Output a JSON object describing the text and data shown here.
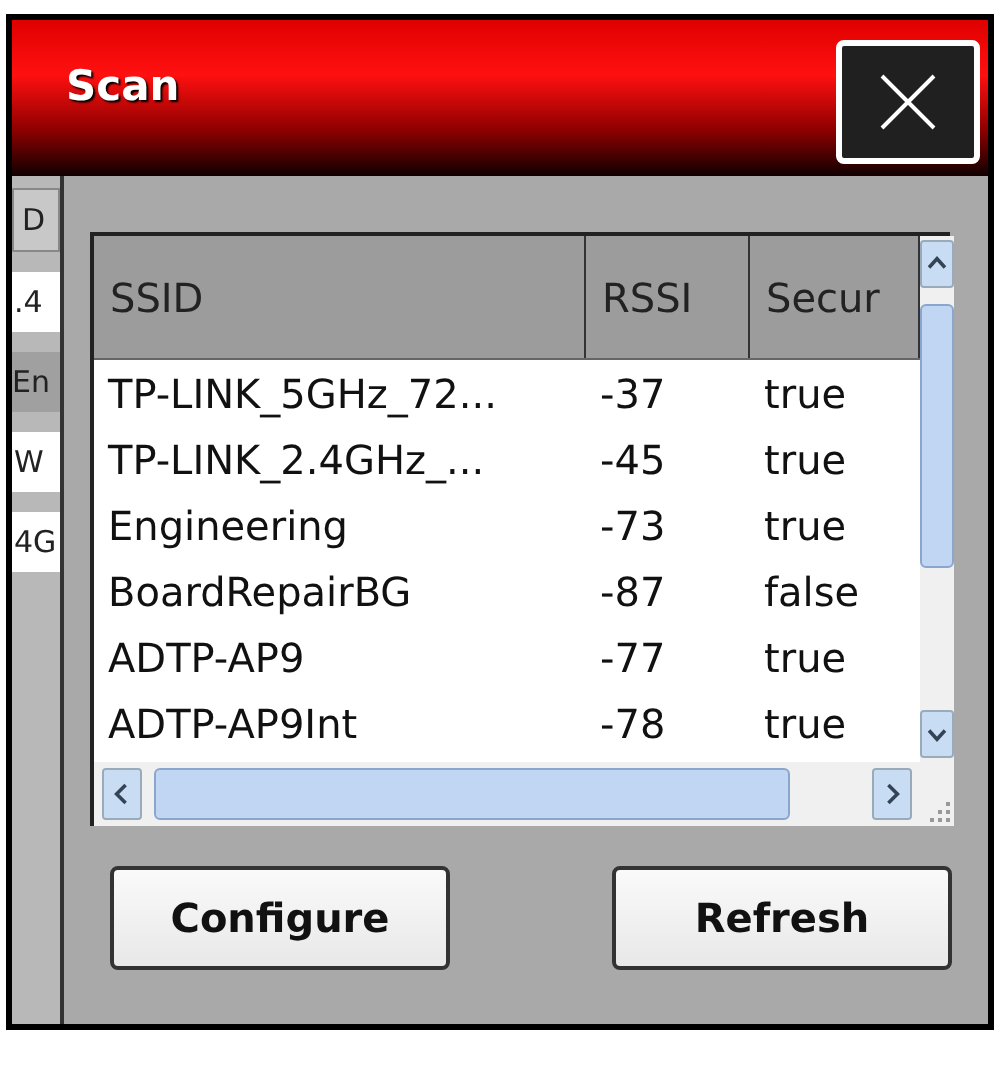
{
  "window": {
    "title": "Scan"
  },
  "background_window": [
    {
      "kind": "tab",
      "text": "D"
    },
    {
      "kind": "field",
      "text": ".4"
    },
    {
      "kind": "label",
      "text": "En"
    },
    {
      "kind": "field",
      "text": "W"
    },
    {
      "kind": "field",
      "text": "4G"
    }
  ],
  "table": {
    "columns": [
      "SSID",
      "RSSI",
      "Secur"
    ],
    "rows": [
      {
        "ssid": "TP-LINK_5GHz_72...",
        "rssi": "-37",
        "secure": "true"
      },
      {
        "ssid": "TP-LINK_2.4GHz_...",
        "rssi": "-45",
        "secure": "true"
      },
      {
        "ssid": "Engineering",
        "rssi": "-73",
        "secure": "true"
      },
      {
        "ssid": "BoardRepairBG",
        "rssi": "-87",
        "secure": "false"
      },
      {
        "ssid": "ADTP-AP9",
        "rssi": "-77",
        "secure": "true"
      },
      {
        "ssid": "ADTP-AP9Int",
        "rssi": "-78",
        "secure": "true"
      }
    ]
  },
  "buttons": [
    "Configure",
    "Refresh"
  ]
}
